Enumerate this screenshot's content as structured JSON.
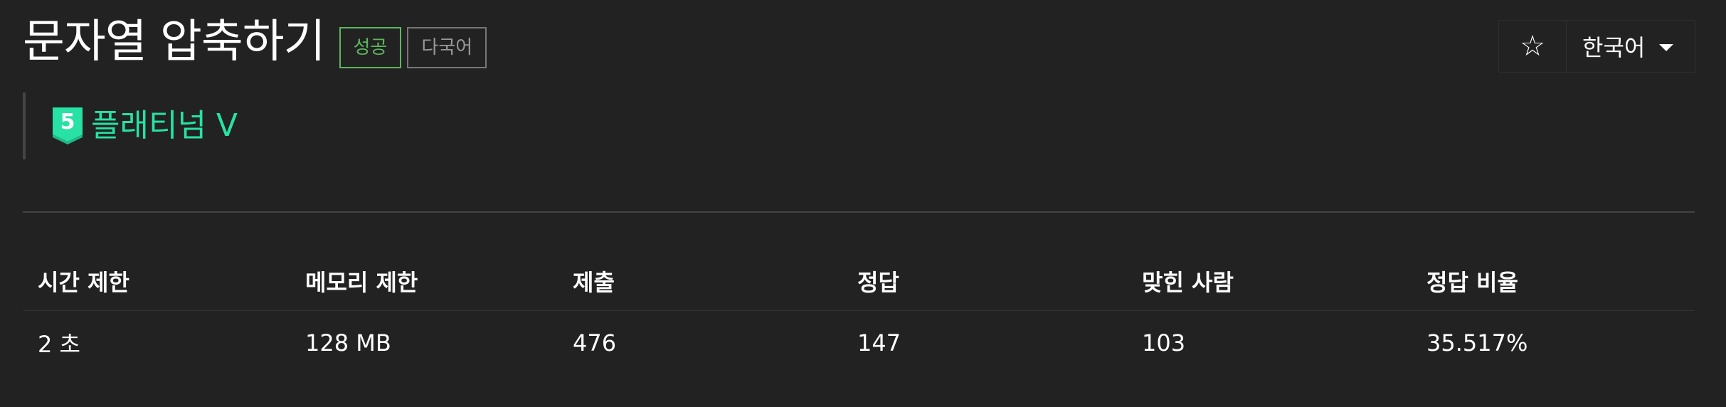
{
  "problem": {
    "title": "문자열 압축하기",
    "badges": {
      "success": "성공",
      "multilang": "다국어"
    }
  },
  "actions": {
    "star_icon": "star-outline-icon",
    "star_glyph": "☆",
    "language": "한국어"
  },
  "tier": {
    "level_number": "5",
    "label": "플래티넘 V",
    "color": "#27e2a4"
  },
  "info_table": {
    "headers": [
      "시간 제한",
      "메모리 제한",
      "제출",
      "정답",
      "맞힌 사람",
      "정답 비율"
    ],
    "values": [
      "2 초",
      "128 MB",
      "476",
      "147",
      "103",
      "35.517%"
    ]
  },
  "colors": {
    "background": "#222222",
    "success": "#5cb85c",
    "tier": "#27e2a4"
  }
}
